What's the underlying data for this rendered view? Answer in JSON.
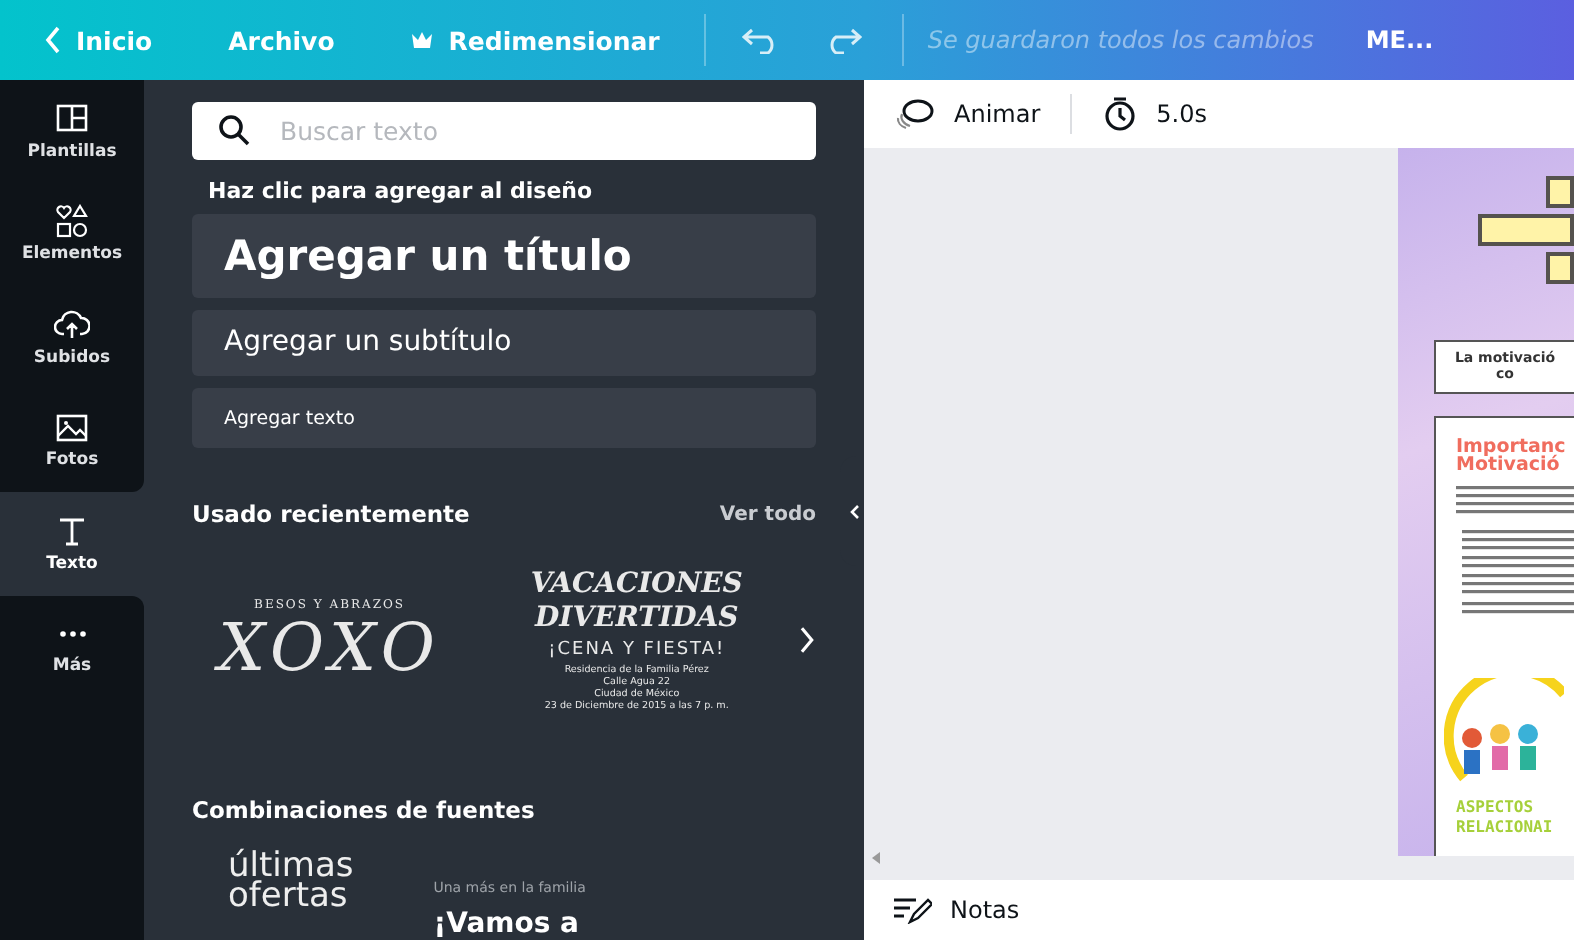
{
  "topbar": {
    "items": [
      {
        "label": "Inicio",
        "kind": "back"
      },
      {
        "label": "Archivo",
        "kind": "plain"
      },
      {
        "label": "Redimensionar",
        "kind": "crown"
      }
    ],
    "save_status": "Se guardaron todos los cambios",
    "menu": "ME..."
  },
  "rail": {
    "items": [
      {
        "label": "Plantillas",
        "kind": "template",
        "selected": false
      },
      {
        "label": "Elementos",
        "kind": "shapes",
        "selected": false
      },
      {
        "label": "Subidos",
        "kind": "upload",
        "selected": false
      },
      {
        "label": "Fotos",
        "kind": "photo",
        "selected": false
      },
      {
        "label": "Texto",
        "kind": "text",
        "selected": true
      },
      {
        "label": "Más",
        "kind": "more",
        "selected": false
      }
    ]
  },
  "panel": {
    "search": {
      "placeholder": "Buscar texto"
    },
    "hint": "Haz clic para agregar al diseño",
    "add_buttons": [
      {
        "label": "Agregar un título",
        "kind": "title"
      },
      {
        "label": "Agregar un subtítulo",
        "kind": "subtitle"
      },
      {
        "label": "Agregar texto",
        "kind": "body"
      }
    ],
    "recent": {
      "title": "Usado recientemente",
      "link": "Ver todo",
      "templates": [
        {
          "kind": "script",
          "lines": [
            "BESOS Y ABRAZOS",
            "XOXO"
          ]
        },
        {
          "kind": "party",
          "lines": [
            "VACACIONES",
            "DIVERTIDAS",
            "¡CENA Y FIESTA!",
            "Residencia de la Familia Pérez",
            "Calle Agua 22",
            "Ciudad de México",
            "23 de Diciembre de 2015 a las 7 p. m."
          ]
        }
      ]
    },
    "combos": {
      "title": "Combinaciones de fuentes",
      "items": [
        {
          "lines": [
            "últimas",
            "ofertas"
          ]
        },
        {
          "lines": [
            "Una más en la familia",
            "¡Vamos a"
          ]
        }
      ]
    }
  },
  "canvas": {
    "animate": "Animar",
    "duration": "5.0s",
    "page": {
      "intro": [
        "La motivació",
        "co"
      ],
      "heading": [
        "Importanc",
        "Motivació"
      ],
      "footer": [
        "ASPECTOS",
        "RELACIONAI"
      ]
    },
    "notes": "Notas"
  }
}
